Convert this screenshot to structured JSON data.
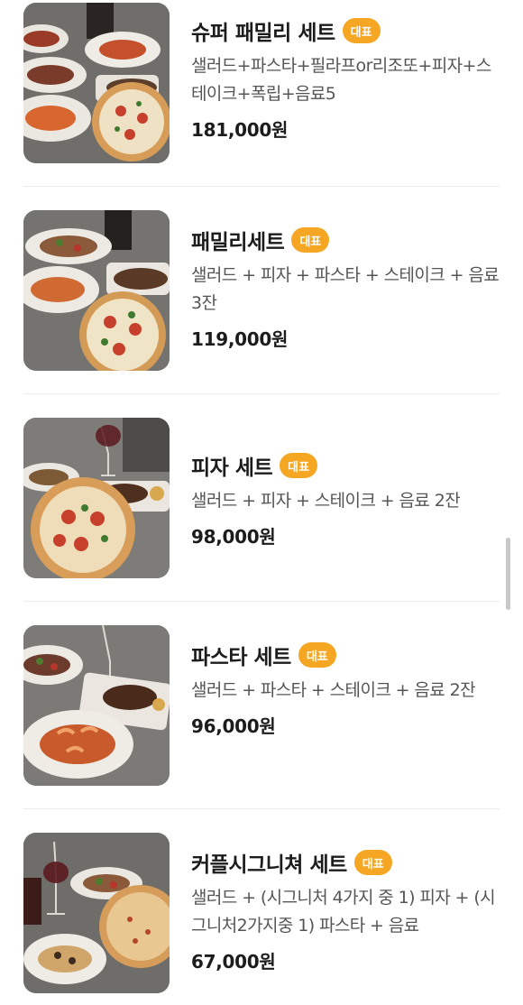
{
  "menu": {
    "items": [
      {
        "title": "슈퍼 패밀리 세트",
        "badge": "대표",
        "description": "샐러드+파스타+필라프or리조또+피자+스테이크+폭립+음료5",
        "price": "181,000원"
      },
      {
        "title": "패밀리세트",
        "badge": "대표",
        "description": "샐러드 + 피자 + 파스타 + 스테이크 + 음료3잔",
        "price": "119,000원"
      },
      {
        "title": "피자 세트",
        "badge": "대표",
        "description": "샐러드 + 피자 + 스테이크 + 음료 2잔",
        "price": "98,000원"
      },
      {
        "title": "파스타 세트",
        "badge": "대표",
        "description": "샐러드 + 파스타 + 스테이크 + 음료 2잔",
        "price": "96,000원"
      },
      {
        "title": "커플시그니쳐 세트",
        "badge": "대표",
        "description": "샐러드 + (시그니처 4가지 중 1) 피자 + (시그니처2가지중 1) 파스타 + 음료",
        "price": "67,000원"
      }
    ]
  },
  "colors": {
    "badge": "#f5a623",
    "thumb_bg": "#7b7a76"
  }
}
